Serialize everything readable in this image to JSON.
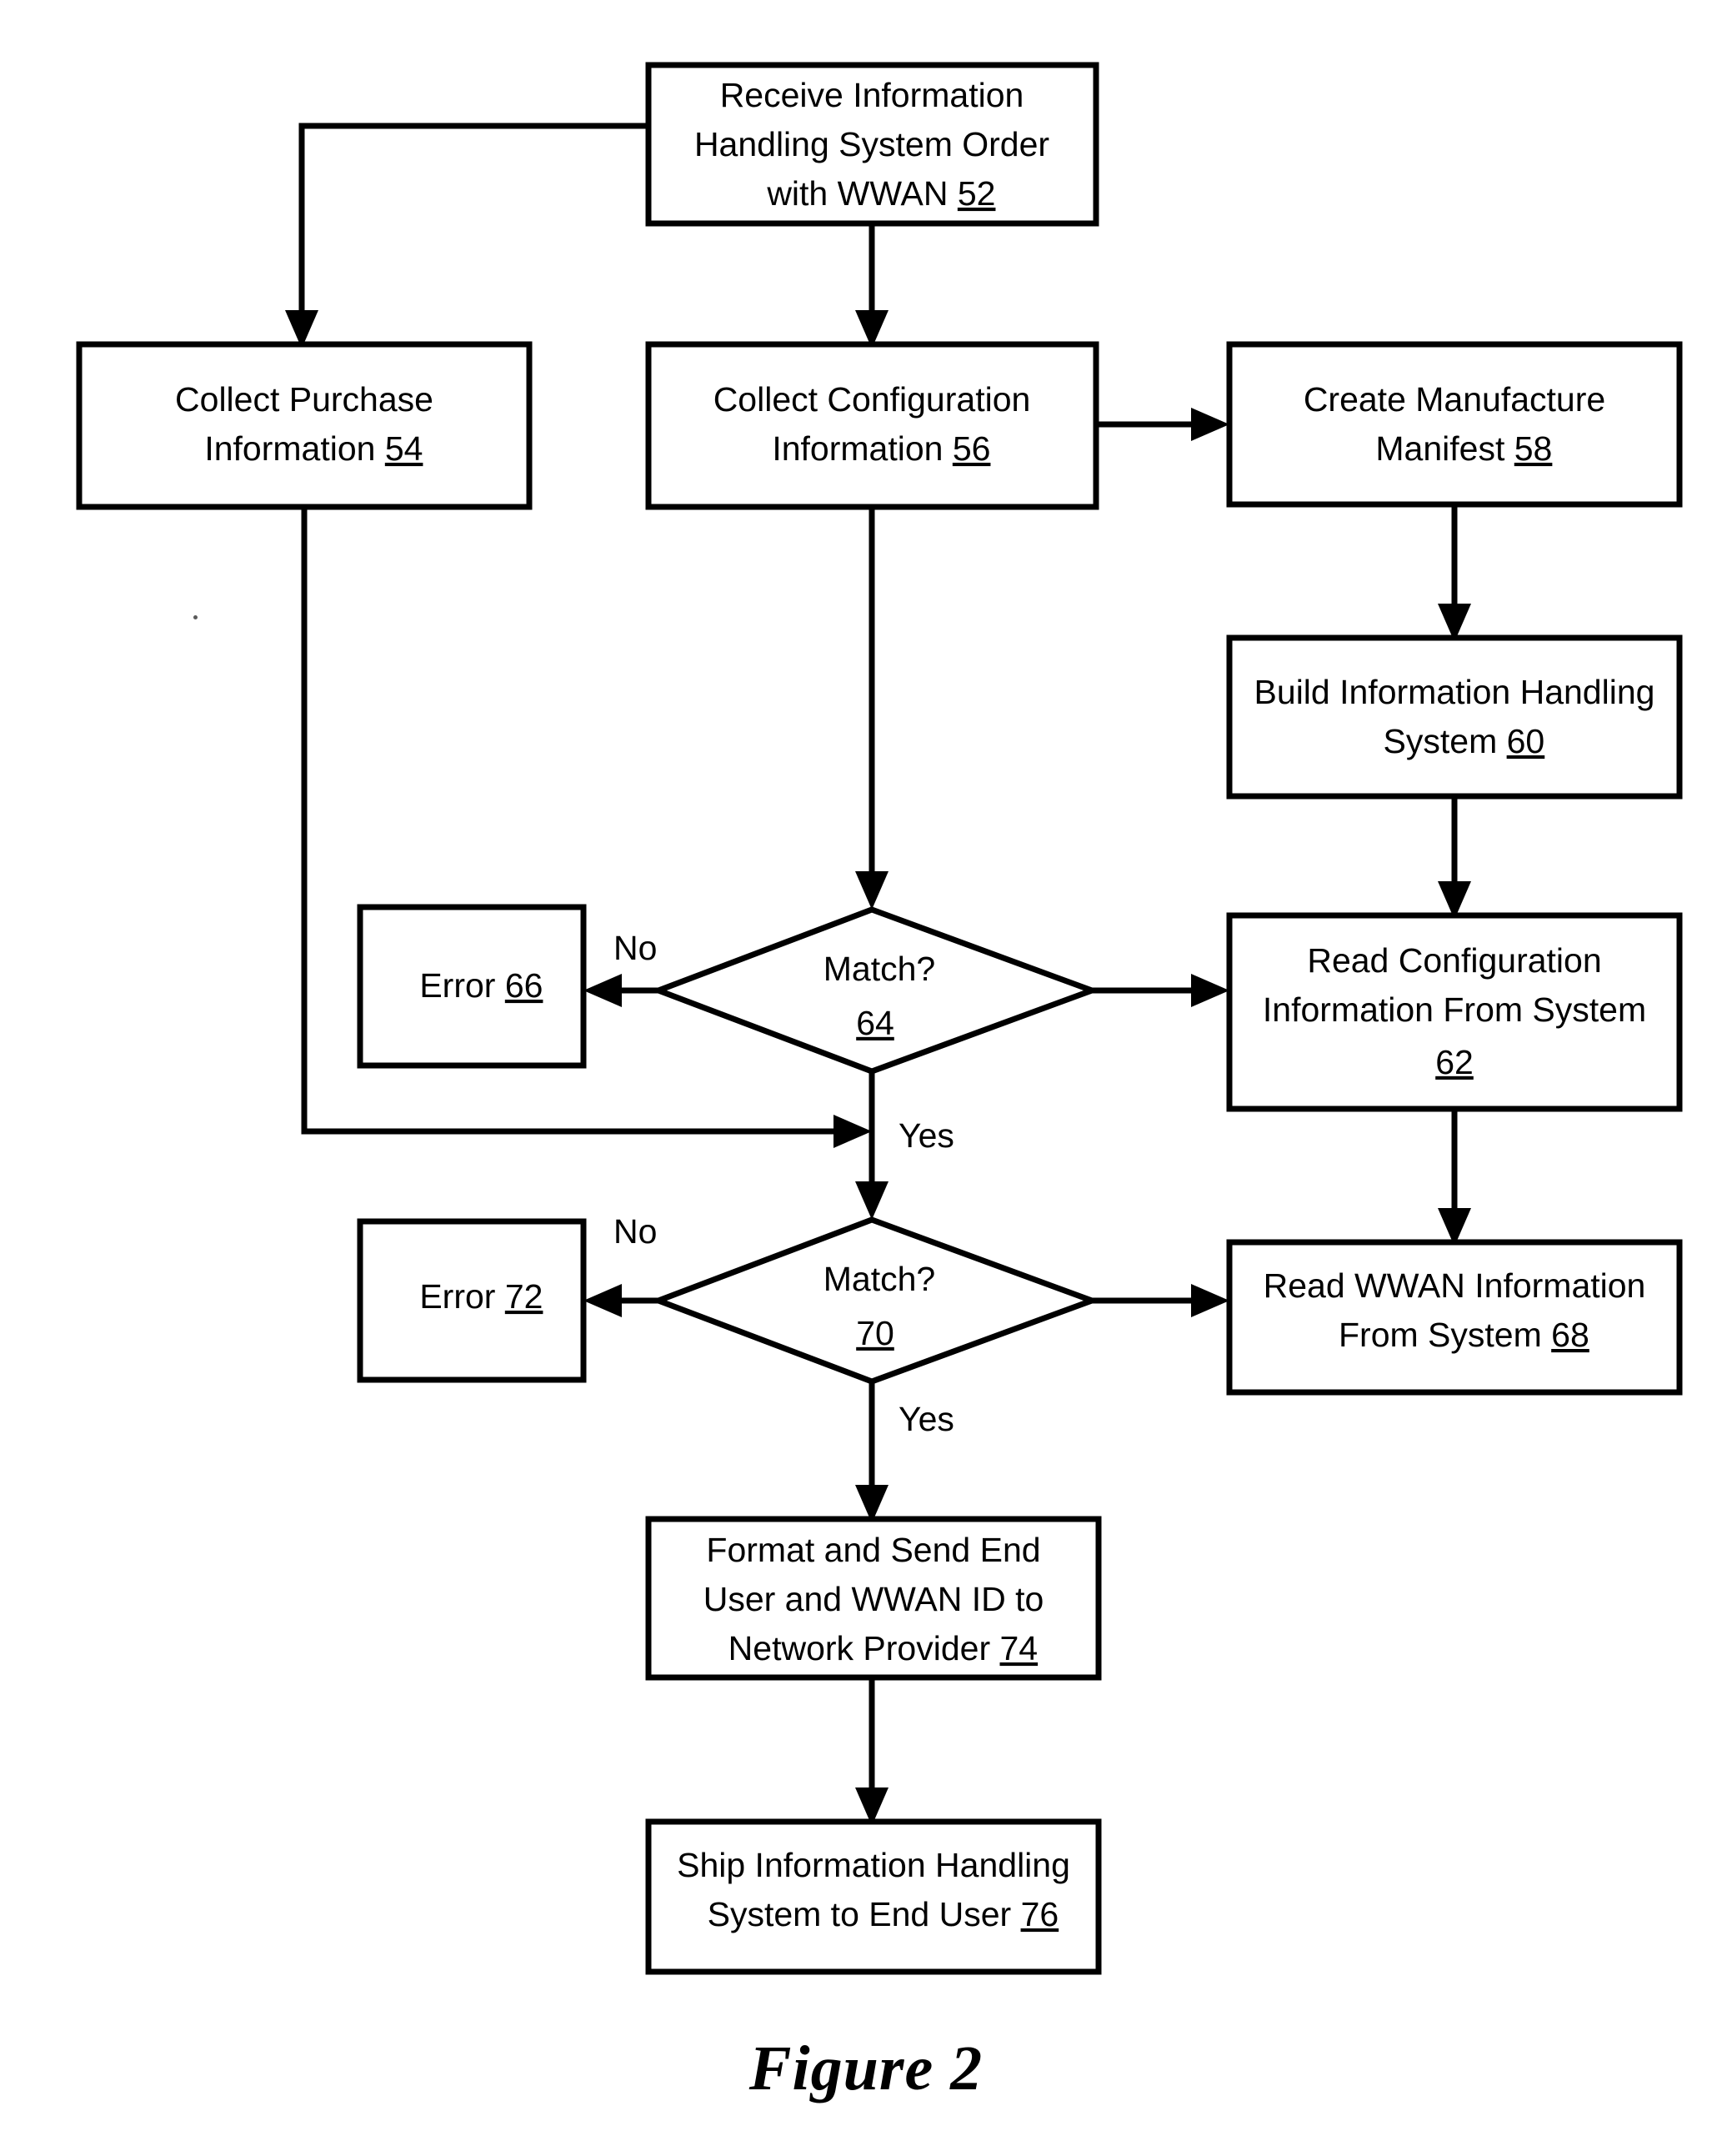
{
  "figure": {
    "caption": "Figure 2",
    "type": "process-flowchart",
    "orientation": "top-to-bottom"
  },
  "nodes": [
    {
      "id": "n52",
      "shape": "process",
      "ref": "52",
      "lines": [
        "Receive Information",
        "Handling System Order",
        "with WWAN "
      ],
      "text": "Receive Information Handling System Order with WWAN 52"
    },
    {
      "id": "n54",
      "shape": "process",
      "ref": "54",
      "lines": [
        "Collect Purchase",
        "Information "
      ],
      "text": "Collect Purchase Information 54"
    },
    {
      "id": "n56",
      "shape": "process",
      "ref": "56",
      "lines": [
        "Collect Configuration",
        "Information "
      ],
      "text": "Collect Configuration Information 56"
    },
    {
      "id": "n58",
      "shape": "process",
      "ref": "58",
      "lines": [
        "Create Manufacture",
        "Manifest "
      ],
      "text": "Create Manufacture Manifest 58"
    },
    {
      "id": "n60",
      "shape": "process",
      "ref": "60",
      "lines": [
        "Build Information Handling",
        "System "
      ],
      "text": "Build Information Handling System 60"
    },
    {
      "id": "n62",
      "shape": "process",
      "ref": "62",
      "lines": [
        "Read Configuration",
        "Information From System",
        ""
      ],
      "text": "Read Configuration Information From System 62"
    },
    {
      "id": "n64",
      "shape": "decision",
      "ref": "64",
      "lines": [
        "Match?",
        ""
      ],
      "text": "Match? 64"
    },
    {
      "id": "n66",
      "shape": "process",
      "ref": "66",
      "lines": [
        "Error "
      ],
      "text": "Error 66"
    },
    {
      "id": "n68",
      "shape": "process",
      "ref": "68",
      "lines": [
        "Read WWAN Information",
        "From System "
      ],
      "text": "Read WWAN Information From System 68"
    },
    {
      "id": "n70",
      "shape": "decision",
      "ref": "70",
      "lines": [
        "Match?",
        ""
      ],
      "text": "Match? 70"
    },
    {
      "id": "n72",
      "shape": "process",
      "ref": "72",
      "lines": [
        "Error "
      ],
      "text": "Error 72"
    },
    {
      "id": "n74",
      "shape": "process",
      "ref": "74",
      "lines": [
        "Format and Send End",
        "User and WWAN ID to",
        "Network Provider "
      ],
      "text": "Format and Send End User and WWAN ID to Network Provider 74"
    },
    {
      "id": "n76",
      "shape": "process",
      "ref": "76",
      "lines": [
        "Ship Information Handling",
        "System to End User "
      ],
      "text": "Ship Information Handling System to End User 76"
    }
  ],
  "node_text": {
    "n52_l1": "Receive Information",
    "n52_l2": "Handling System Order",
    "n52_l3a": "with WWAN ",
    "n52_l3b": "52",
    "n54_l1": "Collect Purchase",
    "n54_l2a": "Information ",
    "n54_l2b": "54",
    "n56_l1": "Collect Configuration",
    "n56_l2a": "Information ",
    "n56_l2b": "56",
    "n58_l1": "Create Manufacture",
    "n58_l2a": "Manifest ",
    "n58_l2b": "58",
    "n60_l1": "Build Information Handling",
    "n60_l2a": "System ",
    "n60_l2b": "60",
    "n62_l1": "Read Configuration",
    "n62_l2": "Information From System",
    "n62_l3": "62",
    "n64_l1": "Match?",
    "n64_l2": "64",
    "n66_l1a": "Error ",
    "n66_l1b": "66",
    "n68_l1": "Read WWAN Information",
    "n68_l2a": "From System ",
    "n68_l2b": "68",
    "n70_l1": "Match?",
    "n70_l2": "70",
    "n72_l1a": "Error ",
    "n72_l1b": "72",
    "n74_l1": "Format and Send End",
    "n74_l2": "User and WWAN ID to",
    "n74_l3a": "Network Provider ",
    "n74_l3b": "74",
    "n76_l1": "Ship Information Handling",
    "n76_l2a": "System to End User ",
    "n76_l2b": "76"
  },
  "edge_labels": {
    "no_64": "No",
    "yes_64": "Yes",
    "no_70": "No",
    "yes_70": "Yes"
  },
  "edges": [
    {
      "id": "e1",
      "from": "n52",
      "to": "n54",
      "label": "",
      "route": "left-down"
    },
    {
      "id": "e2",
      "from": "n52",
      "to": "n56",
      "label": "",
      "route": "down"
    },
    {
      "id": "e3",
      "from": "n56",
      "to": "n58",
      "label": "",
      "route": "right"
    },
    {
      "id": "e4",
      "from": "n58",
      "to": "n60",
      "label": "",
      "route": "down"
    },
    {
      "id": "e5",
      "from": "n60",
      "to": "n62",
      "label": "",
      "route": "down"
    },
    {
      "id": "e6",
      "from": "n56",
      "to": "n64",
      "label": "",
      "route": "down"
    },
    {
      "id": "e7",
      "from": "n64",
      "to": "n66",
      "label": "No",
      "route": "left"
    },
    {
      "id": "e8",
      "from": "n64",
      "to": "n62",
      "label": "",
      "route": "right"
    },
    {
      "id": "e9",
      "from": "n54",
      "to": "n64-yes-junction",
      "label": "",
      "route": "down-right"
    },
    {
      "id": "e10",
      "from": "n64",
      "to": "n70",
      "label": "Yes",
      "route": "down"
    },
    {
      "id": "e11",
      "from": "n62",
      "to": "n68",
      "label": "",
      "route": "down"
    },
    {
      "id": "e12",
      "from": "n70",
      "to": "n72",
      "label": "No",
      "route": "left"
    },
    {
      "id": "e13",
      "from": "n70",
      "to": "n68",
      "label": "",
      "route": "right"
    },
    {
      "id": "e14",
      "from": "n70",
      "to": "n74",
      "label": "Yes",
      "route": "down"
    },
    {
      "id": "e15",
      "from": "n74",
      "to": "n76",
      "label": "",
      "route": "down"
    }
  ],
  "colors": {
    "stroke": "#000000",
    "fill": "#ffffff",
    "background": "#ffffff"
  }
}
